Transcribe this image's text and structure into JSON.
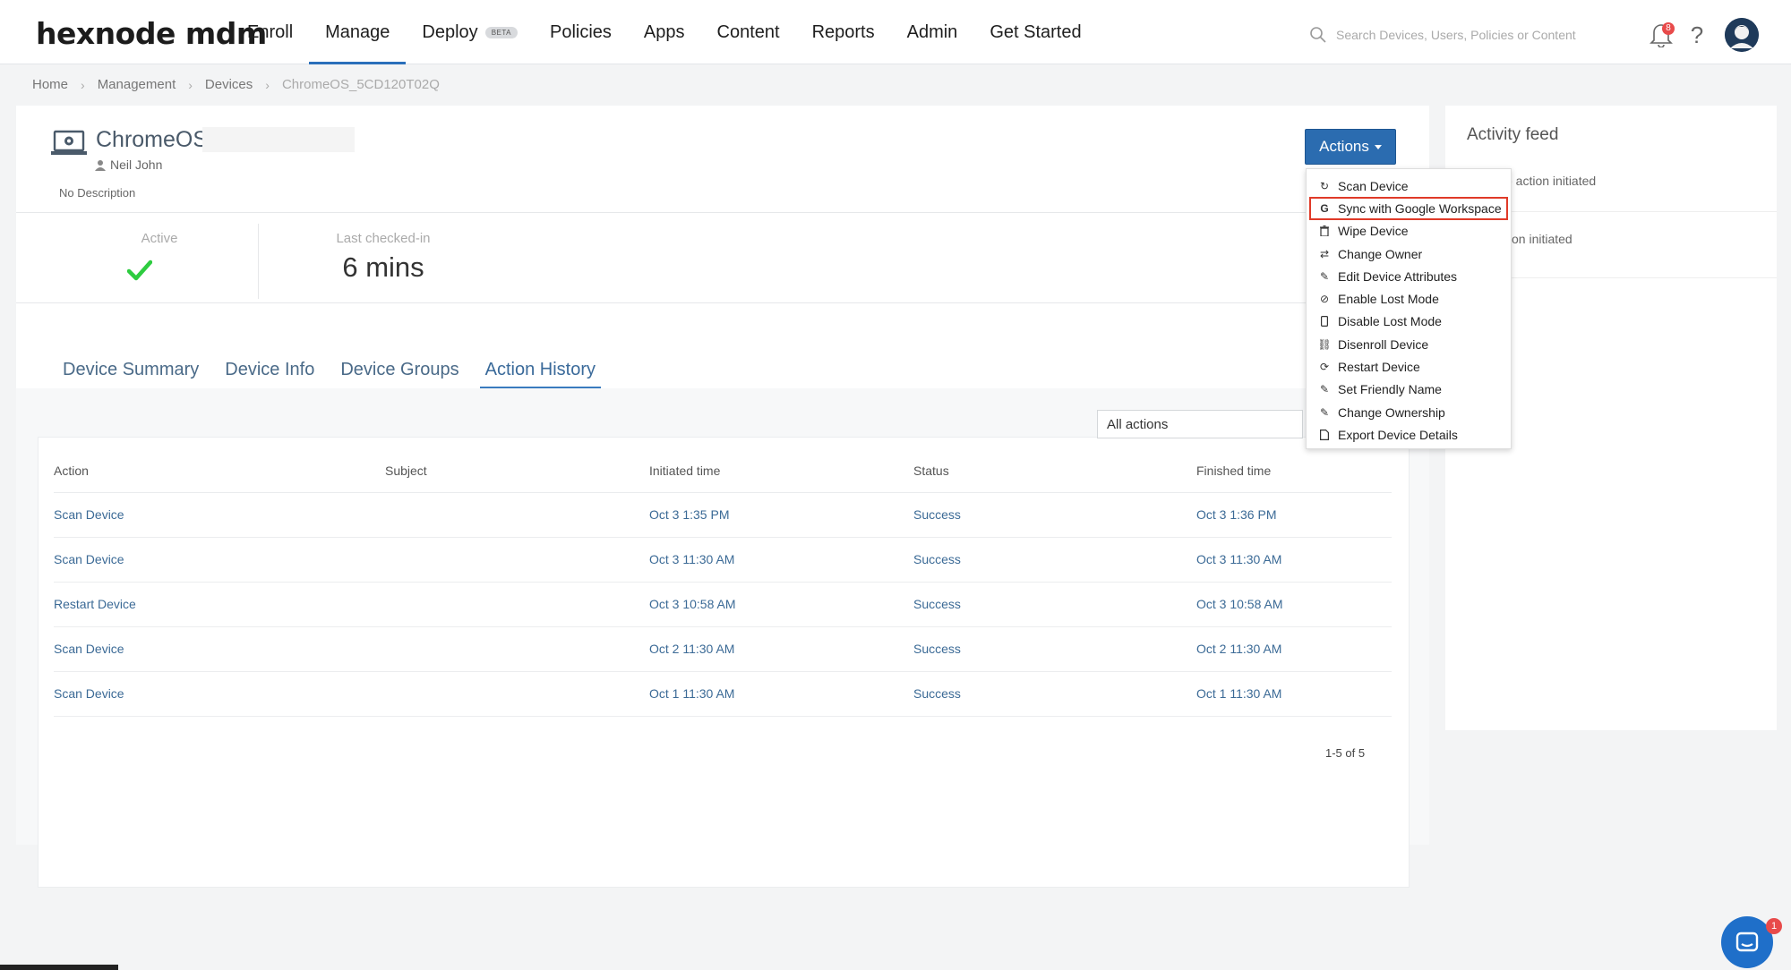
{
  "logo": "hexnode mdm",
  "nav": {
    "items": [
      {
        "label": "Enroll"
      },
      {
        "label": "Manage"
      },
      {
        "label": "Deploy",
        "badge": "BETA"
      },
      {
        "label": "Policies"
      },
      {
        "label": "Apps"
      },
      {
        "label": "Content"
      },
      {
        "label": "Reports"
      },
      {
        "label": "Admin"
      },
      {
        "label": "Get Started"
      }
    ],
    "active": "Manage"
  },
  "search": {
    "placeholder": "Search Devices, Users, Policies or Content"
  },
  "notifications": {
    "count": "8"
  },
  "breadcrumb": [
    "Home",
    "Management",
    "Devices",
    "ChromeOS_5CD120T02Q"
  ],
  "device": {
    "name": "ChromeOS",
    "owner": "Neil John",
    "description": "No Description",
    "status_label": "Active",
    "last_checkin_label": "Last checked-in",
    "last_checkin_value": "6 mins"
  },
  "actions_button": "Actions",
  "actions_menu": [
    {
      "label": "Scan Device",
      "icon": "refresh-icon"
    },
    {
      "label": "Sync with Google Workspace",
      "icon": "google-icon",
      "highlighted": true
    },
    {
      "label": "Wipe Device",
      "icon": "trash-icon"
    },
    {
      "label": "Change Owner",
      "icon": "swap-icon"
    },
    {
      "label": "Edit Device Attributes",
      "icon": "pencil-icon"
    },
    {
      "label": "Enable Lost Mode",
      "icon": "lost-mode-icon"
    },
    {
      "label": "Disable Lost Mode",
      "icon": "phone-icon"
    },
    {
      "label": "Disenroll Device",
      "icon": "unlink-icon"
    },
    {
      "label": "Restart Device",
      "icon": "restart-icon"
    },
    {
      "label": "Set Friendly Name",
      "icon": "pencil-icon"
    },
    {
      "label": "Change Ownership",
      "icon": "pencil-icon"
    },
    {
      "label": "Export Device Details",
      "icon": "pdf-icon"
    }
  ],
  "tabs": [
    {
      "label": "Device Summary"
    },
    {
      "label": "Device Info"
    },
    {
      "label": "Device Groups"
    },
    {
      "label": "Action History"
    }
  ],
  "active_tab": "Action History",
  "filter": {
    "value": "All actions"
  },
  "table": {
    "headers": [
      "Action",
      "Subject",
      "Initiated time",
      "Status",
      "Finished time"
    ],
    "rows": [
      [
        "Scan Device",
        "",
        "Oct 3 1:35 PM",
        "Success",
        "Oct 3 1:36 PM"
      ],
      [
        "Scan Device",
        "",
        "Oct 3 11:30 AM",
        "Success",
        "Oct 3 11:30 AM"
      ],
      [
        "Restart Device",
        "",
        "Oct 3 10:58 AM",
        "Success",
        "Oct 3 10:58 AM"
      ],
      [
        "Scan Device",
        "",
        "Oct 2 11:30 AM",
        "Success",
        "Oct 2 11:30 AM"
      ],
      [
        "Scan Device",
        "",
        "Oct 1 11:30 AM",
        "Success",
        "Oct 1 11:30 AM"
      ]
    ]
  },
  "pagination": "1-5 of 5",
  "activity_feed": {
    "title": "Activity feed",
    "items": [
      "ce action initiated",
      "ction initiated"
    ]
  },
  "chat": {
    "badge": "1"
  },
  "colors": {
    "accent": "#2b6cb0",
    "highlight": "#e03a28",
    "success": "#2ecc40"
  }
}
